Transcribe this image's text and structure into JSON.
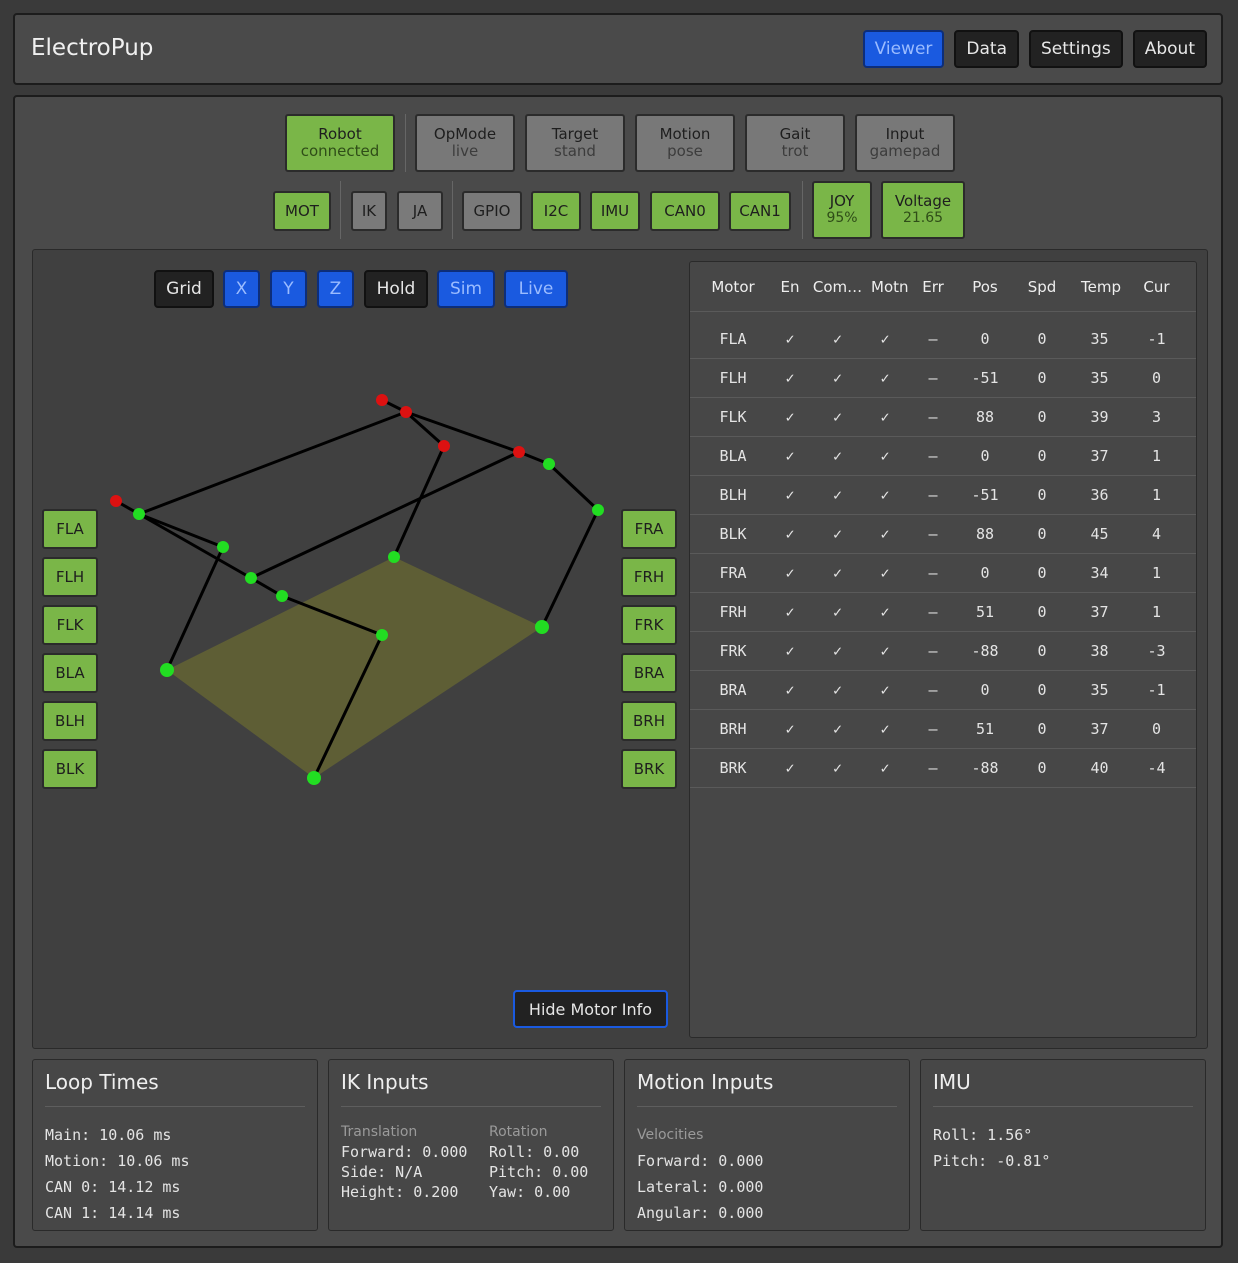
{
  "app_title": "ElectroPup",
  "nav": [
    "Viewer",
    "Data",
    "Settings",
    "About"
  ],
  "status": [
    {
      "label": "Robot",
      "value": "connected"
    },
    {
      "label": "OpMode",
      "value": "live"
    },
    {
      "label": "Target",
      "value": "stand"
    },
    {
      "label": "Motion",
      "value": "pose"
    },
    {
      "label": "Gait",
      "value": "trot"
    },
    {
      "label": "Input",
      "value": "gamepad"
    }
  ],
  "chips": [
    "MOT",
    "IK",
    "JA",
    "GPIO",
    "I2C",
    "IMU",
    "CAN0",
    "CAN1"
  ],
  "joy": {
    "label": "JOY",
    "value": "95%"
  },
  "voltage": {
    "label": "Voltage",
    "value": "21.65"
  },
  "viewer_toggles": [
    "Grid",
    "X",
    "Y",
    "Z",
    "Hold",
    "Sim",
    "Live"
  ],
  "left_motors": [
    "FLA",
    "FLH",
    "FLK",
    "BLA",
    "BLH",
    "BLK"
  ],
  "right_motors": [
    "FRA",
    "FRH",
    "FRK",
    "BRA",
    "BRH",
    "BRK"
  ],
  "motor_table": {
    "headers": [
      "Motor",
      "En",
      "Com…",
      "Motn",
      "Err",
      "Pos",
      "Spd",
      "Temp",
      "Cur"
    ],
    "rows": [
      [
        "FLA",
        "✓",
        "✓",
        "✓",
        "–",
        "0",
        "0",
        "35",
        "-1"
      ],
      [
        "FLH",
        "✓",
        "✓",
        "✓",
        "–",
        "-51",
        "0",
        "35",
        "0"
      ],
      [
        "FLK",
        "✓",
        "✓",
        "✓",
        "–",
        "88",
        "0",
        "39",
        "3"
      ],
      [
        "BLA",
        "✓",
        "✓",
        "✓",
        "–",
        "0",
        "0",
        "37",
        "1"
      ],
      [
        "BLH",
        "✓",
        "✓",
        "✓",
        "–",
        "-51",
        "0",
        "36",
        "1"
      ],
      [
        "BLK",
        "✓",
        "✓",
        "✓",
        "–",
        "88",
        "0",
        "45",
        "4"
      ],
      [
        "FRA",
        "✓",
        "✓",
        "✓",
        "–",
        "0",
        "0",
        "34",
        "1"
      ],
      [
        "FRH",
        "✓",
        "✓",
        "✓",
        "–",
        "51",
        "0",
        "37",
        "1"
      ],
      [
        "FRK",
        "✓",
        "✓",
        "✓",
        "–",
        "-88",
        "0",
        "38",
        "-3"
      ],
      [
        "BRA",
        "✓",
        "✓",
        "✓",
        "–",
        "0",
        "0",
        "35",
        "-1"
      ],
      [
        "BRH",
        "✓",
        "✓",
        "✓",
        "–",
        "51",
        "0",
        "37",
        "0"
      ],
      [
        "BRK",
        "✓",
        "✓",
        "✓",
        "–",
        "-88",
        "0",
        "40",
        "-4"
      ]
    ]
  },
  "hide_motor_info": "Hide Motor Info",
  "loop_times": {
    "title": "Loop Times",
    "lines": [
      "Main: 10.06 ms",
      "Motion: 10.06 ms",
      "CAN 0: 14.12 ms",
      "CAN 1: 14.14 ms"
    ]
  },
  "ik_inputs": {
    "title": "IK Inputs",
    "translation_label": "Translation",
    "translation": [
      "Forward: 0.000",
      "Side: N/A",
      "Height: 0.200"
    ],
    "rotation_label": "Rotation",
    "rotation": [
      "Roll: 0.00",
      "Pitch: 0.00",
      "Yaw: 0.00"
    ]
  },
  "motion_inputs": {
    "title": "Motion Inputs",
    "velocities_label": "Velocities",
    "lines": [
      "Forward: 0.000",
      "Lateral: 0.000",
      "Angular: 0.000"
    ]
  },
  "imu": {
    "title": "IMU",
    "lines": [
      "Roll: 1.56°",
      "Pitch: -0.81°"
    ]
  },
  "colors": {
    "ok": "#7ab648",
    "active": "#1a5ae0",
    "joint_green": "#22dd22",
    "joint_red": "#dd1111",
    "ground": "#6b6b30"
  }
}
